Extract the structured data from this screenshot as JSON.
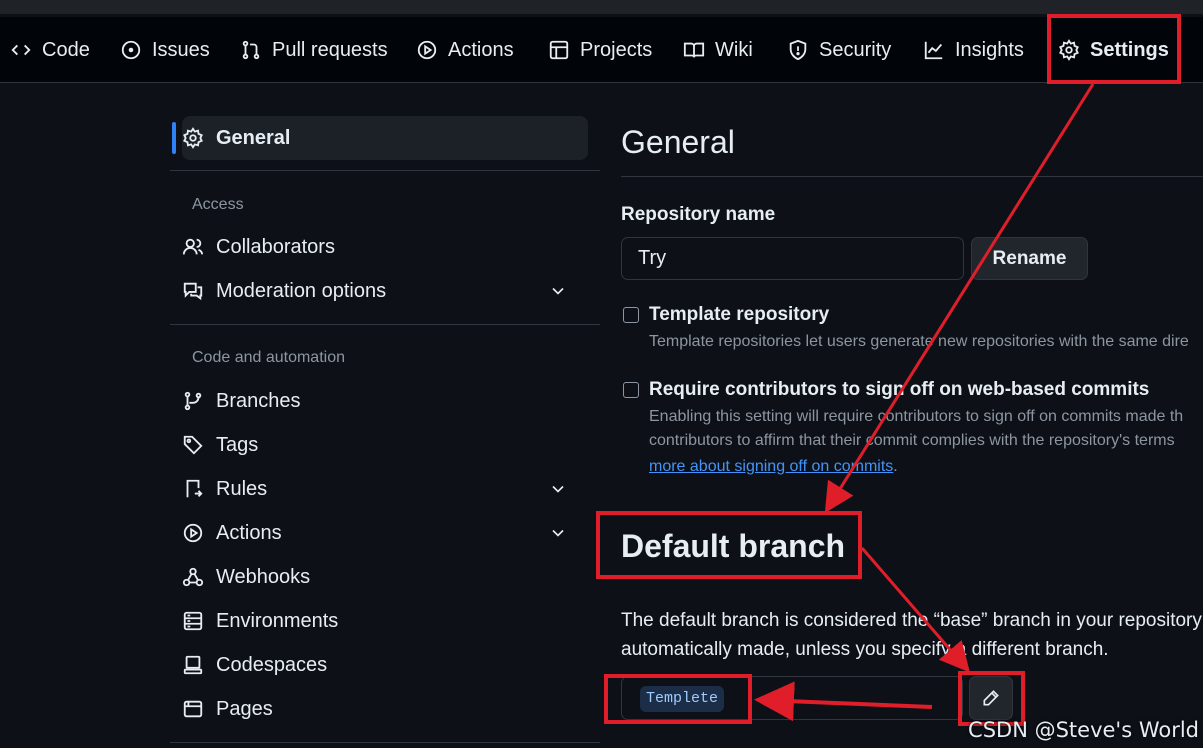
{
  "tabs": [
    {
      "label": "Code",
      "icon": "code-icon"
    },
    {
      "label": "Issues",
      "icon": "issue-icon"
    },
    {
      "label": "Pull requests",
      "icon": "pull-request-icon"
    },
    {
      "label": "Actions",
      "icon": "play-icon"
    },
    {
      "label": "Projects",
      "icon": "table-icon"
    },
    {
      "label": "Wiki",
      "icon": "book-icon"
    },
    {
      "label": "Security",
      "icon": "shield-icon"
    },
    {
      "label": "Insights",
      "icon": "graph-icon"
    },
    {
      "label": "Settings",
      "icon": "gear-icon",
      "active": true
    }
  ],
  "sidebar": {
    "general": "General",
    "access_heading": "Access",
    "collaborators": "Collaborators",
    "moderation": "Moderation options",
    "code_heading": "Code and automation",
    "branches": "Branches",
    "tags": "Tags",
    "rules": "Rules",
    "actions": "Actions",
    "webhooks": "Webhooks",
    "environments": "Environments",
    "codespaces": "Codespaces",
    "pages": "Pages"
  },
  "main": {
    "title": "General",
    "repo_label": "Repository name",
    "repo_value": "Try",
    "rename": "Rename",
    "template_title": "Template repository",
    "template_desc": "Template repositories let users generate new repositories with the same dire",
    "signoff_title": "Require contributors to sign off on web-based commits",
    "signoff_desc1": "Enabling this setting will require contributors to sign off on commits made th",
    "signoff_desc2": "contributors to affirm that their commit complies with the repository's terms",
    "signoff_link": "more about signing off on commits",
    "signoff_period": ".",
    "default_title": "Default branch",
    "default_desc1": "The default branch is considered the “base” branch in your repository",
    "default_desc2": "automatically made, unless you specify a different branch.",
    "branch_name": "Templete"
  },
  "watermark": "CSDN @Steve's World",
  "colors": {
    "annotation": "#e01e2a",
    "accent": "#2f81f7",
    "link": "#4493f8"
  }
}
